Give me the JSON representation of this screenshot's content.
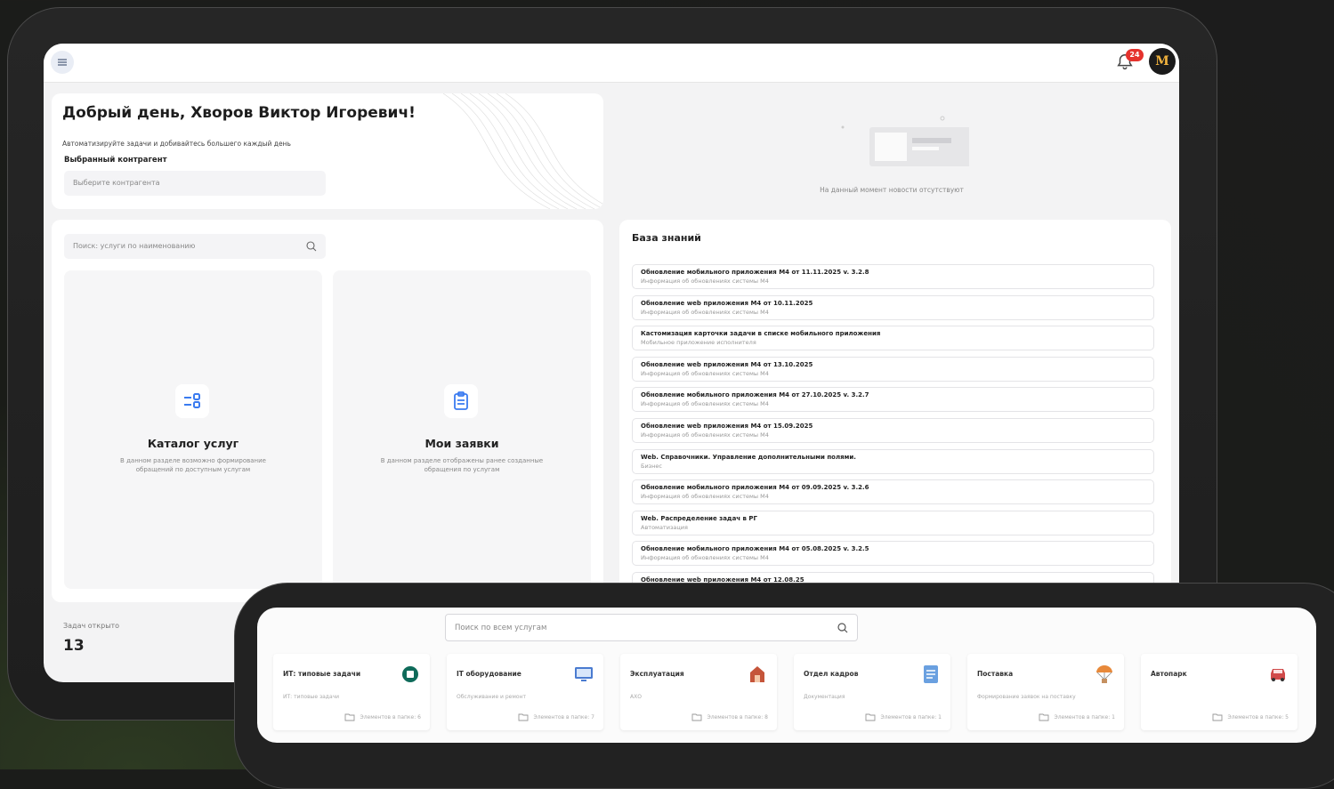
{
  "topbar": {
    "notifications_count": "24",
    "avatar_initials": "M"
  },
  "greeting": {
    "title": "Добрый день, Хворов Виктор Игоревич!",
    "subtitle": "Автоматизируйте задачи и добивайтесь большего каждый день",
    "contractor_label": "Выбранный контрагент",
    "contractor_placeholder": "Выберите контрагента"
  },
  "news": {
    "empty_text": "На данный момент новости отсутствуют"
  },
  "services": {
    "search_placeholder": "Поиск: услуги по наименованию",
    "tiles": [
      {
        "title": "Каталог услуг",
        "description": "В данном разделе возможно формирование обращений по доступным услугам",
        "icon": "catalog-icon"
      },
      {
        "title": "Мои заявки",
        "description": "В данном разделе отображены ранее созданные обращения по услугам",
        "icon": "clipboard-icon"
      }
    ]
  },
  "knowledge_base": {
    "title": "База знаний",
    "items": [
      {
        "title": "Обновление мобильного приложения M4 от 11.11.2025 v. 3.2.8",
        "desc": "Информация об обновлениях системы M4"
      },
      {
        "title": "Обновление web приложения M4 от 10.11.2025",
        "desc": "Информация об обновлениях системы M4"
      },
      {
        "title": "Кастомизация карточки задачи в списке мобильного приложения",
        "desc": "Мобильное приложение исполнителя"
      },
      {
        "title": "Обновление web приложения M4 от 13.10.2025",
        "desc": "Информация об обновлениях системы M4"
      },
      {
        "title": "Обновление мобильного приложения M4 от 27.10.2025 v. 3.2.7",
        "desc": "Информация об обновлениях системы M4"
      },
      {
        "title": "Обновление web приложения M4 от 15.09.2025",
        "desc": "Информация об обновлениях системы M4"
      },
      {
        "title": "Web. Справочники. Управление дополнительными полями.",
        "desc": "Бизнес"
      },
      {
        "title": "Обновление мобильного приложения M4 от 09.09.2025 v. 3.2.6",
        "desc": "Информация об обновлениях системы M4"
      },
      {
        "title": "Web. Распределение задач в РГ",
        "desc": "Автоматизация"
      },
      {
        "title": "Обновление мобильного приложения M4 от 05.08.2025 v. 3.2.5",
        "desc": "Информация об обновлениях системы M4"
      },
      {
        "title": "Обновление web приложения M4 от 12.08.25",
        "desc": ""
      }
    ]
  },
  "tasks": {
    "label": "Задач открыто",
    "count": "13"
  },
  "catalog": {
    "search_placeholder": "Поиск по всем услугам",
    "items": [
      {
        "title": "ИТ: типовые задачи",
        "desc": "ИТ: типовые задачи",
        "count": "Элементов в папке: 6",
        "icon": "it-tasks-icon",
        "color": "#0f6b5a"
      },
      {
        "title": "IT оборудование",
        "desc": "Обслуживание и ремонт",
        "count": "Элементов в папке: 7",
        "icon": "monitor-icon",
        "color": "#4a7bd0"
      },
      {
        "title": "Эксплуатация",
        "desc": "АХО",
        "count": "Элементов в папке: 8",
        "icon": "building-icon",
        "color": "#c5553a"
      },
      {
        "title": "Отдел кадров",
        "desc": "Документация",
        "count": "Элементов в папке: 1",
        "icon": "document-icon",
        "color": "#6aa0e0"
      },
      {
        "title": "Поставка",
        "desc": "Формирование заявок на поставку",
        "count": "Элементов в папке: 1",
        "icon": "parachute-icon",
        "color": "#e8893a"
      },
      {
        "title": "Автопарк",
        "desc": "",
        "count": "Элементов в папке: 5",
        "icon": "car-icon",
        "color": "#d04a4a"
      }
    ]
  }
}
